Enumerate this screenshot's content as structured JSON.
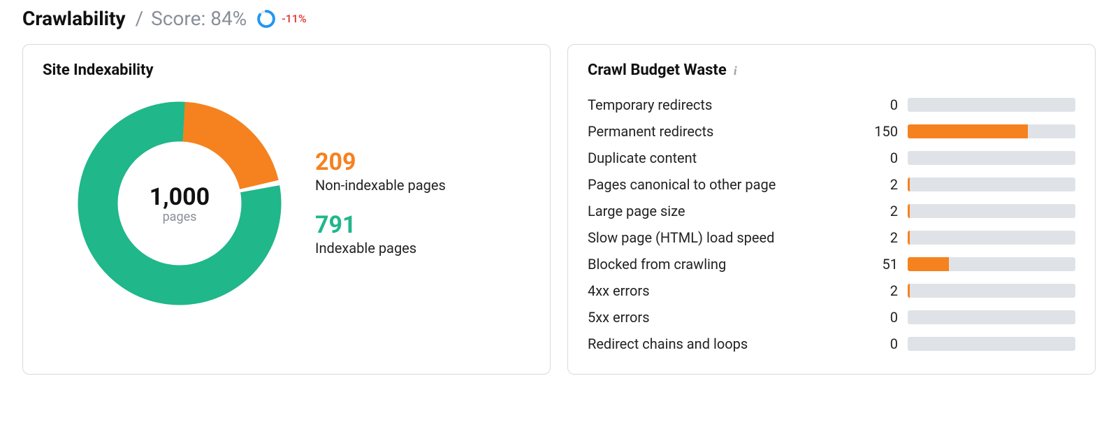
{
  "header": {
    "title": "Crawlability",
    "score_prefix": "/",
    "score_label": "Score:",
    "score_value": "84%",
    "score_percent": 84,
    "delta": "-11%",
    "accent_color": "#2196f3",
    "delta_color": "#e03131"
  },
  "site_indexability": {
    "title": "Site Indexability",
    "total": "1,000",
    "total_label": "pages",
    "non_indexable": {
      "value": 209,
      "label": "Non-indexable pages",
      "color": "#f5821f"
    },
    "indexable": {
      "value": 791,
      "label": "Indexable pages",
      "color": "#20b78a"
    }
  },
  "crawl_budget_waste": {
    "title": "Crawl Budget Waste",
    "bar_color": "#f5821f",
    "items": [
      {
        "label": "Temporary redirects",
        "value": 0
      },
      {
        "label": "Permanent redirects",
        "value": 150
      },
      {
        "label": "Duplicate content",
        "value": 0
      },
      {
        "label": "Pages canonical to other page",
        "value": 2
      },
      {
        "label": "Large page size",
        "value": 2
      },
      {
        "label": "Slow page (HTML) load speed",
        "value": 2
      },
      {
        "label": "Blocked from crawling",
        "value": 51
      },
      {
        "label": "4xx errors",
        "value": 2
      },
      {
        "label": "5xx errors",
        "value": 0
      },
      {
        "label": "Redirect chains and loops",
        "value": 0
      }
    ]
  },
  "chart_data": [
    {
      "type": "pie",
      "title": "Site Indexability",
      "series": [
        {
          "name": "Non-indexable pages",
          "value": 209
        },
        {
          "name": "Indexable pages",
          "value": 791
        }
      ],
      "total": 1000
    },
    {
      "type": "bar",
      "title": "Crawl Budget Waste",
      "categories": [
        "Temporary redirects",
        "Permanent redirects",
        "Duplicate content",
        "Pages canonical to other page",
        "Large page size",
        "Slow page (HTML) load speed",
        "Blocked from crawling",
        "4xx errors",
        "5xx errors",
        "Redirect chains and loops"
      ],
      "values": [
        0,
        150,
        0,
        2,
        2,
        2,
        51,
        2,
        0,
        0
      ]
    }
  ]
}
